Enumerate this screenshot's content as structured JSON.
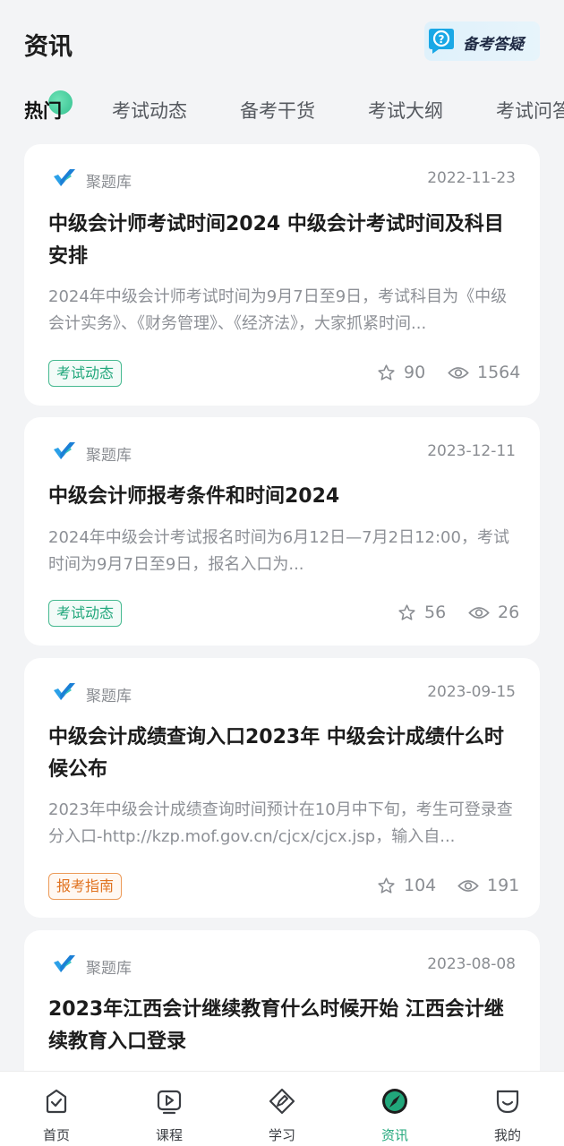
{
  "header": {
    "title": "资讯",
    "qa_button_label": "备考答疑"
  },
  "tabs": [
    {
      "label": "热门",
      "active": true
    },
    {
      "label": "考试动态"
    },
    {
      "label": "备考干货"
    },
    {
      "label": "考试大纲"
    },
    {
      "label": "考试问答"
    }
  ],
  "articles": [
    {
      "source": "聚题库",
      "date": "2022-11-23",
      "title": "中级会计师考试时间2024 中级会计考试时间及科目安排",
      "summary": "2024年中级会计师考试时间为9月7日至9日，考试科目为《中级会计实务》、《财务管理》、《经济法》，大家抓紧时间...",
      "tag": "考试动态",
      "favorites": "90",
      "views": "1564"
    },
    {
      "source": "聚题库",
      "date": "2023-12-11",
      "title": "中级会计师报考条件和时间2024",
      "summary": "2024年中级会计考试报名时间为6月12日—7月2日12:00，考试时间为9月7日至9日，报名入口为...",
      "tag": "考试动态",
      "favorites": "56",
      "views": "26"
    },
    {
      "source": "聚题库",
      "date": "2023-09-15",
      "title": "中级会计成绩查询入口2023年 中级会计成绩什么时候公布",
      "summary": "2023年中级会计成绩查询时间预计在10月中下旬，考生可登录查分入口-http://kzp.mof.gov.cn/cjcx/cjcx.jsp，输入自...",
      "tag": "报考指南",
      "favorites": "104",
      "views": "191"
    },
    {
      "source": "聚题库",
      "date": "2023-08-08",
      "title": "2023年江西会计继续教育什么时候开始 江西会计继续教育入口登录"
    }
  ],
  "bottom_nav": [
    {
      "label": "首页",
      "icon": "home-icon"
    },
    {
      "label": "课程",
      "icon": "course-play-icon"
    },
    {
      "label": "学习",
      "icon": "study-pencil-icon"
    },
    {
      "label": "资讯",
      "icon": "news-compass-icon",
      "active": true
    },
    {
      "label": "我的",
      "icon": "profile-icon"
    }
  ],
  "colors": {
    "accent": "#21a77b",
    "tag_green": "#21a77b",
    "tag_orange": "#e0721f",
    "background": "#f3f4f6"
  }
}
